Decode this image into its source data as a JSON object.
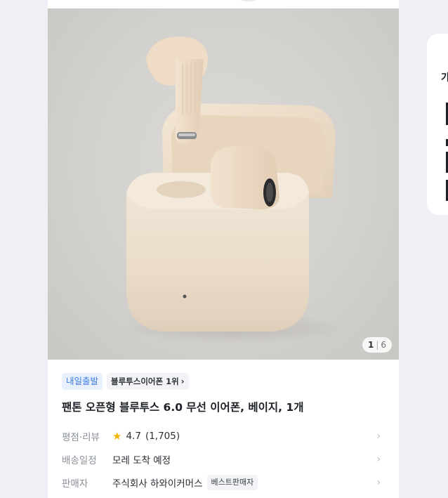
{
  "gallery": {
    "current": "1",
    "total": "6",
    "separator": "|"
  },
  "badges": {
    "delivery": "내일출발",
    "rank": "블루투스이어폰 1위"
  },
  "product": {
    "title": "팬톤 오픈형 블루투스 6.0 무선 이어폰, 베이지, 1개"
  },
  "rows": {
    "rating": {
      "label": "평점·리뷰",
      "score": "4.7",
      "count": "(1,705)"
    },
    "shipping": {
      "label": "배송일정",
      "value": "모레 도착 예정"
    },
    "seller": {
      "label": "판매자",
      "name": "주식회사 하와이커머스",
      "badge": "베스트판매자"
    }
  },
  "side_panel": {
    "text": "가"
  },
  "colors": {
    "accent_blue": "#3a7ae6",
    "star": "#f5b400",
    "page_bg": "#eef0f5"
  }
}
